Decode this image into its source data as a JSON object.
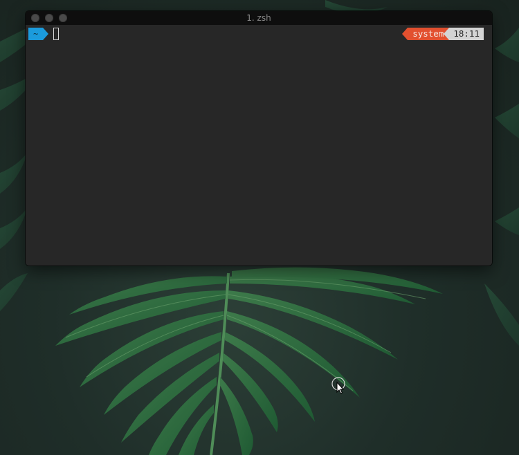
{
  "window": {
    "title": "1. zsh"
  },
  "prompt": {
    "directory": "~",
    "environment": "system",
    "time": "18:11"
  },
  "colors": {
    "directory_segment": "#1b9bdc",
    "environment_segment": "#e2502f",
    "time_segment": "#d4d4d4",
    "terminal_background": "#272727",
    "titlebar": "#0e0e0e"
  },
  "icons": [
    "close-dot-icon",
    "minimize-dot-icon",
    "zoom-dot-icon",
    "mouse-pointer-icon"
  ]
}
